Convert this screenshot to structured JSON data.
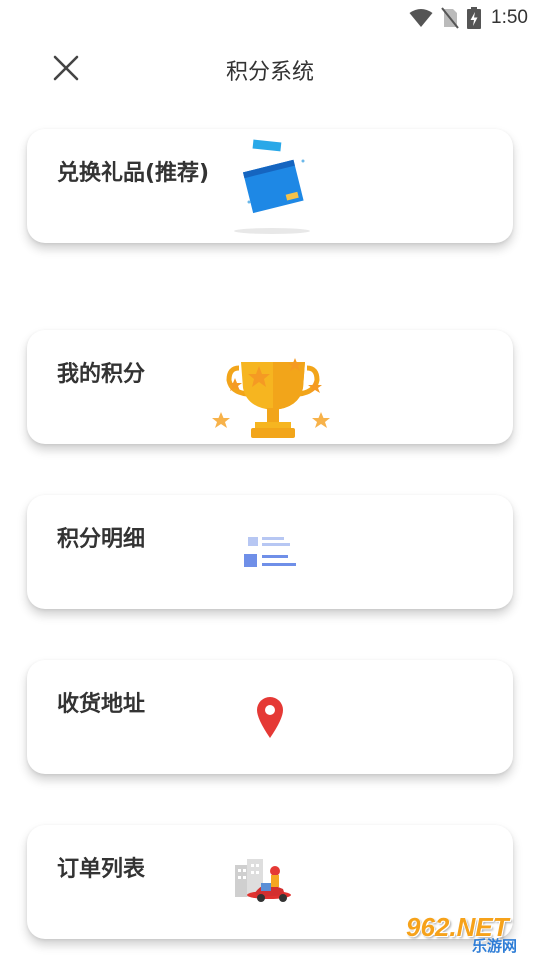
{
  "status_bar": {
    "time": "1:50"
  },
  "header": {
    "title": "积分系统"
  },
  "cards": [
    {
      "label": "兑换礼品(推荐)",
      "icon": "gift-box-icon"
    },
    {
      "label": "我的积分",
      "icon": "trophy-icon"
    },
    {
      "label": "积分明细",
      "icon": "list-detail-icon"
    },
    {
      "label": "收货地址",
      "icon": "location-pin-icon"
    },
    {
      "label": "订单列表",
      "icon": "delivery-scooter-icon"
    }
  ],
  "watermark": {
    "big": "962.NET",
    "small": "乐游网"
  },
  "colors": {
    "text": "#333333",
    "box_blue": "#1e88e5",
    "trophy_gold": "#f6b520",
    "star_orange": "#f59a23",
    "list_blue": "#6f8fe8",
    "pin_red": "#e53935",
    "watermark_orange": "#f6a21a",
    "watermark_blue": "#2e7dd6"
  }
}
